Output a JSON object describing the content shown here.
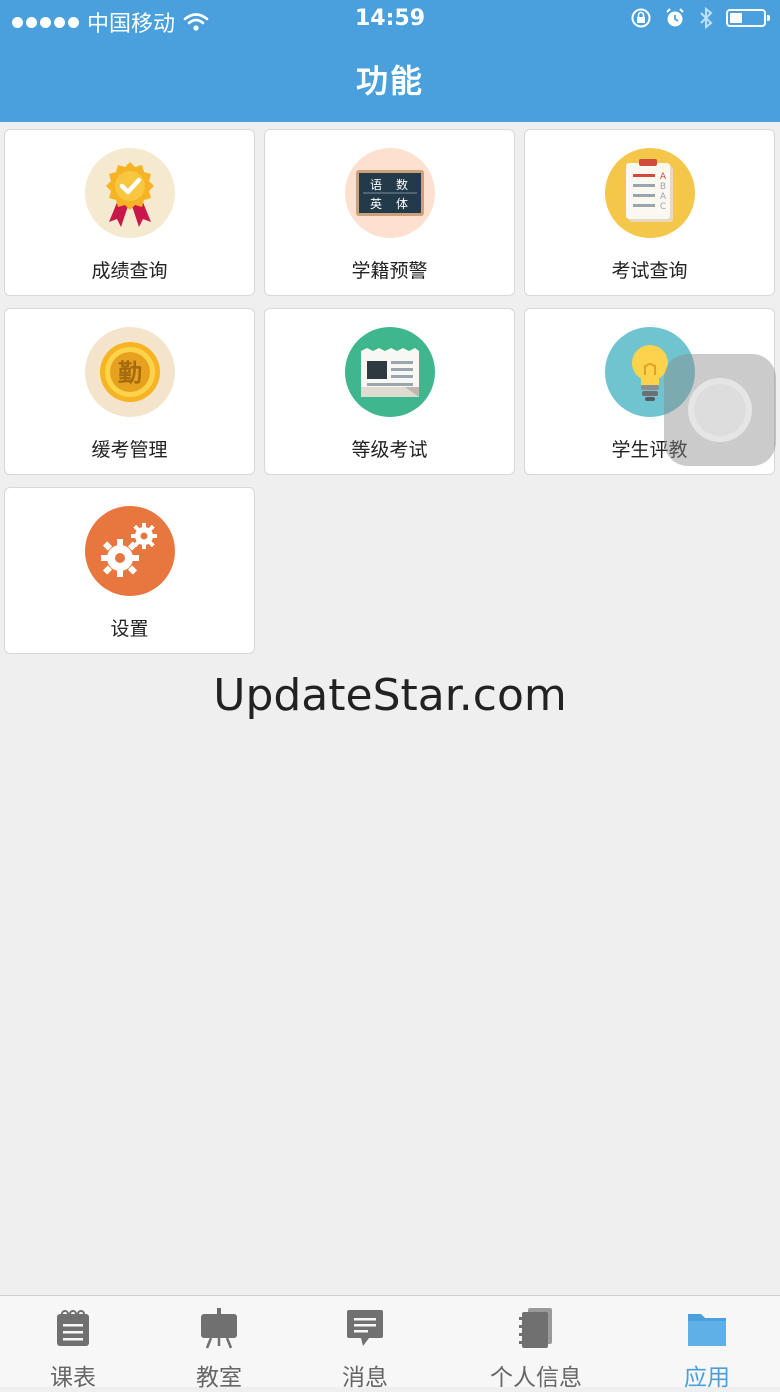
{
  "status_bar": {
    "carrier": "中国移动",
    "time": "14:59"
  },
  "header": {
    "title": "功能"
  },
  "tiles": [
    {
      "label": "成绩查询",
      "icon": "medal-icon",
      "bg": "#f5ead0"
    },
    {
      "label": "学籍预警",
      "icon": "blackboard-icon",
      "bg": "#fde0cf",
      "board_text": [
        "语",
        "数",
        "英",
        "体"
      ]
    },
    {
      "label": "考试查询",
      "icon": "exam-paper-icon",
      "bg": "#f4c64a",
      "paper_marks": [
        "A",
        "B",
        "A",
        "C"
      ]
    },
    {
      "label": "缓考管理",
      "icon": "coin-icon",
      "bg": "#f5e4cc",
      "coin_char": "勤"
    },
    {
      "label": "等级考试",
      "icon": "newspaper-icon",
      "bg": "#3fb68d"
    },
    {
      "label": "学生评教",
      "icon": "lightbulb-icon",
      "bg": "#6fc4cf"
    },
    {
      "label": "设置",
      "icon": "gears-icon",
      "bg": "#e7773f"
    }
  ],
  "watermark": "UpdateStar.com",
  "tabbar": {
    "items": [
      {
        "label": "课表",
        "icon": "schedule-icon",
        "active": false
      },
      {
        "label": "教室",
        "icon": "classroom-icon",
        "active": false
      },
      {
        "label": "消息",
        "icon": "message-icon",
        "active": false
      },
      {
        "label": "个人信息",
        "icon": "contacts-icon",
        "active": false
      },
      {
        "label": "应用",
        "icon": "folder-icon",
        "active": true
      }
    ]
  },
  "colors": {
    "header": "#4aa0dc",
    "active_tab": "#4aa0dc",
    "inactive_tab": "#666666",
    "background": "#efefef"
  }
}
